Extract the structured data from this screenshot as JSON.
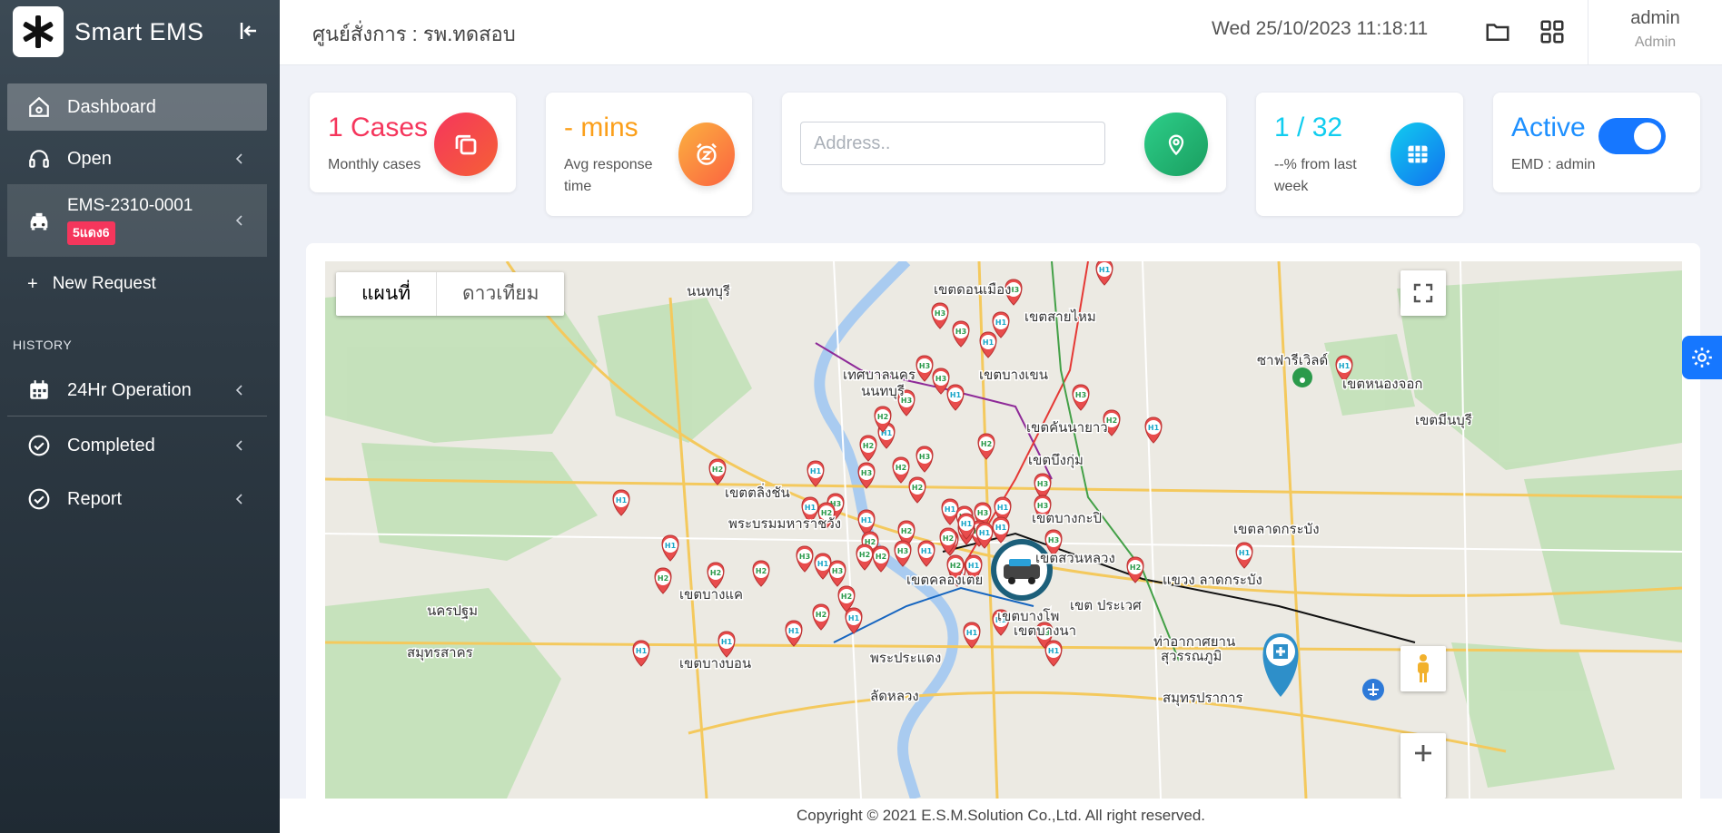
{
  "sidebar": {
    "brand": "Smart EMS",
    "items": [
      {
        "label": "Dashboard"
      },
      {
        "label": "Open"
      },
      {
        "label": "EMS-2310-0001",
        "badge": "5แดง6"
      },
      {
        "label": "New Request"
      }
    ],
    "history_label": "HISTORY",
    "history_items": [
      {
        "label": "24Hr Operation"
      },
      {
        "label": "Completed"
      },
      {
        "label": "Report"
      }
    ]
  },
  "header": {
    "title": "ศูนย์สั่งการ : รพ.ทดสอบ",
    "datetime": "Wed 25/10/2023 11:18:11",
    "user_name": "admin",
    "user_role": "Admin"
  },
  "cards": {
    "cases": {
      "value": "1 Cases",
      "label": "Monthly cases",
      "color": "#f5365c"
    },
    "response": {
      "value": "- mins",
      "label_line1": "Avg response",
      "label_line2": "time",
      "color": "#fb9f1a"
    },
    "address": {
      "placeholder": "Address.."
    },
    "weekly": {
      "value": "1 / 32",
      "label_line1": "--% from last",
      "label_line2": "week",
      "color": "#11cdef"
    },
    "status": {
      "value": "Active",
      "label": "EMD : admin",
      "toggle_on": true,
      "color": "#1677ff"
    }
  },
  "map": {
    "tab_map": "แผนที่",
    "tab_satellite": "ดาวเทียม",
    "labels": [
      {
        "text": "นนทบุรี"
      },
      {
        "text": "เขตดอนเมือง"
      },
      {
        "text": "เขตสายไหม"
      },
      {
        "text": "เทศบาลนคร"
      },
      {
        "text": "นนทบุรี"
      },
      {
        "text": "เขตบางเขน"
      },
      {
        "text": "ซาฟารีเวิลด์"
      },
      {
        "text": "เขตคันนายาว"
      },
      {
        "text": "เขตมีนบุรี"
      },
      {
        "text": "เขตหนองจอก"
      },
      {
        "text": "เขตบึงกุ่ม"
      },
      {
        "text": "เขตตลิ่งชัน"
      },
      {
        "text": "พระบรมมหาราชวัง"
      },
      {
        "text": "เขตบางกะปิ"
      },
      {
        "text": "เขตลาดกระบัง"
      },
      {
        "text": "เขตสวนหลวง"
      },
      {
        "text": "เขตบางแค"
      },
      {
        "text": "เขตคลองเตย"
      },
      {
        "text": "เขต ประเวศ"
      },
      {
        "text": "นครปฐม"
      },
      {
        "text": "สมุทรสาคร"
      },
      {
        "text": "เขตบางบอน"
      },
      {
        "text": "เขตบางนา"
      },
      {
        "text": "ท่าอากาศยาน"
      },
      {
        "text": "สุวรรณภูมิ"
      },
      {
        "text": "สมุทรปราการ"
      },
      {
        "text": "พระประแดง"
      },
      {
        "text": "ลัดหลวง"
      },
      {
        "text": "เขตบางโพ"
      },
      {
        "text": "แขวง ลาดกระบัง"
      }
    ]
  },
  "footer": {
    "text": "Copyright © 2021 E.S.M.Solution Co.,Ltd. All right reserved."
  }
}
